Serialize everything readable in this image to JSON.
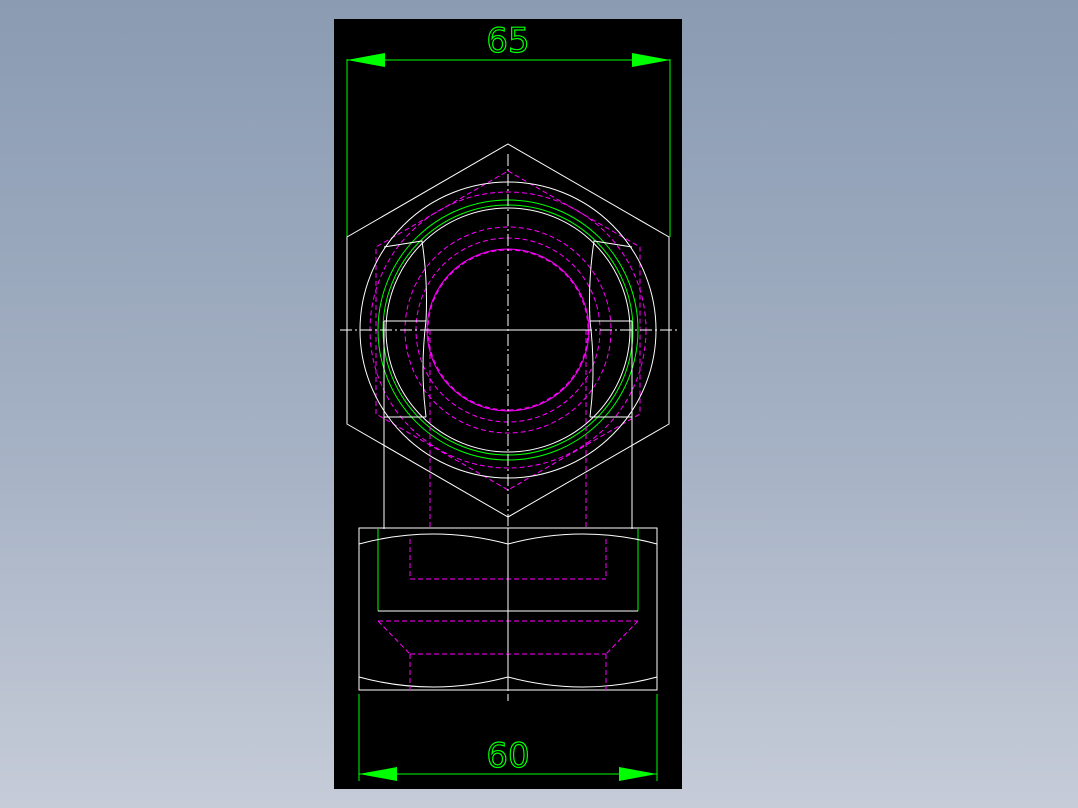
{
  "drawing": {
    "dimension_top": "65",
    "dimension_bottom": "60"
  },
  "colors": {
    "background": "#000000",
    "outline": "#ffffff",
    "hidden": "#ff00ff",
    "dimension": "#00ff00"
  }
}
